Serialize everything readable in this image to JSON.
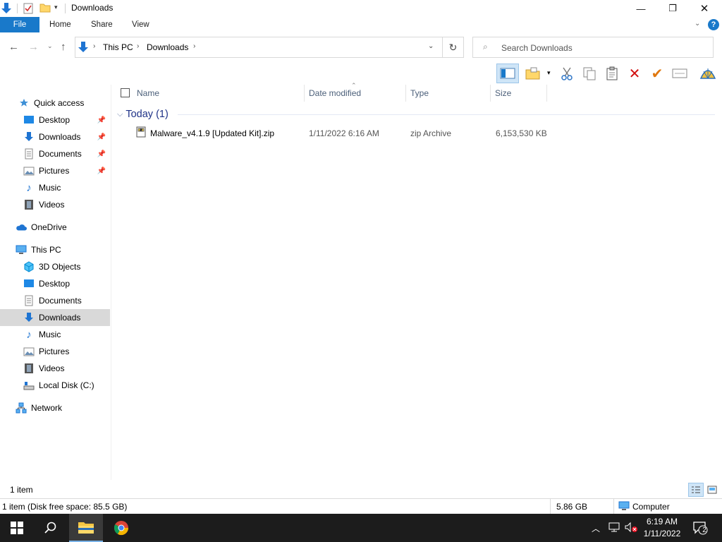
{
  "window": {
    "title": "Downloads",
    "minimize_glyph": "—",
    "maximize_glyph": "❐",
    "close_glyph": "✕"
  },
  "ribbon": {
    "tabs": [
      "File",
      "Home",
      "Share",
      "View"
    ],
    "help_glyph": "?"
  },
  "address": {
    "crumbs": [
      "This PC",
      "Downloads"
    ],
    "search_placeholder": "Search Downloads"
  },
  "nav_pane": {
    "quick_access": {
      "label": "Quick access",
      "items": [
        {
          "label": "Desktop",
          "icon": "desktop-icon",
          "pinned": true
        },
        {
          "label": "Downloads",
          "icon": "downloads-icon",
          "pinned": true
        },
        {
          "label": "Documents",
          "icon": "documents-icon",
          "pinned": true
        },
        {
          "label": "Pictures",
          "icon": "pictures-icon",
          "pinned": true
        },
        {
          "label": "Music",
          "icon": "music-icon",
          "pinned": false
        },
        {
          "label": "Videos",
          "icon": "videos-icon",
          "pinned": false
        }
      ]
    },
    "onedrive": {
      "label": "OneDrive"
    },
    "this_pc": {
      "label": "This PC",
      "items": [
        {
          "label": "3D Objects",
          "icon": "3d-objects-icon"
        },
        {
          "label": "Desktop",
          "icon": "desktop-icon"
        },
        {
          "label": "Documents",
          "icon": "documents-icon"
        },
        {
          "label": "Downloads",
          "icon": "downloads-icon",
          "selected": true
        },
        {
          "label": "Music",
          "icon": "music-icon"
        },
        {
          "label": "Pictures",
          "icon": "pictures-icon"
        },
        {
          "label": "Videos",
          "icon": "videos-icon"
        },
        {
          "label": "Local Disk (C:)",
          "icon": "local-disk-icon"
        }
      ]
    },
    "network": {
      "label": "Network"
    }
  },
  "columns": [
    "Name",
    "Date modified",
    "Type",
    "Size"
  ],
  "group": {
    "label": "Today (1)"
  },
  "files": [
    {
      "name": "Malware_v4.1.9 [Updated Kit].zip",
      "date": "1/11/2022 6:16 AM",
      "type": "zip Archive",
      "size": "6,153,530 KB"
    }
  ],
  "status": {
    "item_count": "1 item",
    "disk_info": "1 item (Disk free space: 85.5 GB)",
    "size_total": "5.86 GB",
    "location": "Computer"
  },
  "taskbar": {
    "time": "6:19 AM",
    "date": "1/11/2022",
    "notifications_count": "2"
  },
  "colors": {
    "accent": "#1979ca",
    "selected_nav": "#d9d9d9",
    "group_header": "#1e3287",
    "taskbar": "#1c1c1c"
  }
}
